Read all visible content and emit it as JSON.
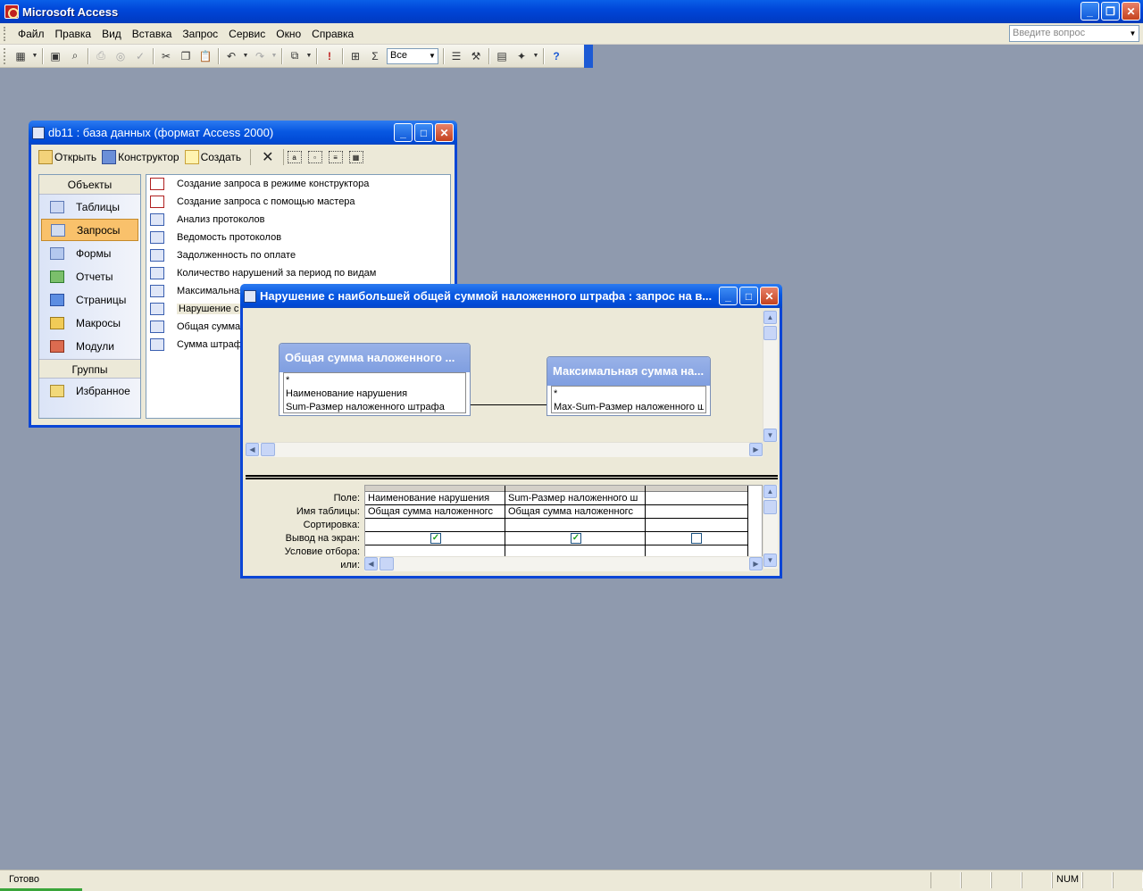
{
  "app": {
    "title": "Microsoft Access"
  },
  "menu": {
    "items": [
      "Файл",
      "Правка",
      "Вид",
      "Вставка",
      "Запрос",
      "Сервис",
      "Окно",
      "Справка"
    ],
    "help_placeholder": "Введите вопрос"
  },
  "toolbar": {
    "top_values_combo": "Все",
    "icons": [
      "view-icon",
      "save-icon",
      "search-icon",
      "print-icon",
      "print-preview-icon",
      "spelling-icon",
      "cut-icon",
      "copy-icon",
      "paste-icon",
      "undo-icon",
      "redo-icon",
      "query-type-icon",
      "run-icon",
      "show-table-icon",
      "totals-icon",
      "properties-icon",
      "build-icon",
      "database-window-icon",
      "new-object-icon",
      "help-icon"
    ]
  },
  "db_window": {
    "title": "db11 : база данных (формат Access 2000)",
    "toolbar": {
      "open": "Открыть",
      "design": "Конструктор",
      "create": "Создать"
    },
    "objects_header": "Объекты",
    "objects": [
      "Таблицы",
      "Запросы",
      "Формы",
      "Отчеты",
      "Страницы",
      "Макросы",
      "Модули"
    ],
    "selected_object": "Запросы",
    "groups_header": "Группы",
    "groups": [
      "Избранное"
    ],
    "queries": [
      "Создание запроса в режиме конструктора",
      "Создание запроса с помощью мастера",
      "Анализ протоколов",
      "Ведомость протоколов",
      "Задолженность по оплате",
      "Количество нарушений за период по видам",
      "Максимальная",
      "Нарушение с н",
      "Общая сумма н",
      "Сумма штрафо"
    ]
  },
  "query_window": {
    "title": "Нарушение с наибольшей общей суммой наложенного штрафа : запрос на в...",
    "tables": [
      {
        "title": "Общая сумма наложенного ...",
        "fields": [
          "*",
          "Наименование нарушения",
          "Sum-Размер наложенного штрафа"
        ]
      },
      {
        "title": "Максимальная сумма на...",
        "fields": [
          "*",
          "Max-Sum-Размер наложенного штр"
        ]
      }
    ],
    "row_labels": [
      "Поле:",
      "Имя таблицы:",
      "Сортировка:",
      "Вывод на экран:",
      "Условие отбора:",
      "или:"
    ],
    "columns": [
      {
        "field": "Наименование нарушения",
        "table": "Общая сумма наложенногс",
        "show": true
      },
      {
        "field": "Sum-Размер наложенного ш",
        "table": "Общая сумма наложенногс",
        "show": true
      },
      {
        "field": "",
        "table": "",
        "show": false
      }
    ]
  },
  "statusbar": {
    "text": "Готово",
    "num": "NUM"
  }
}
